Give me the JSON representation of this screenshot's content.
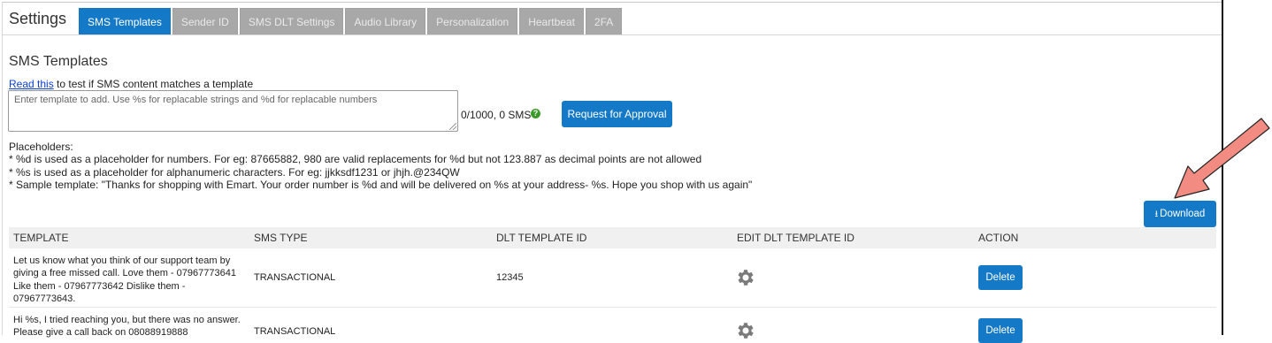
{
  "header": {
    "title": "Settings",
    "tabs": [
      {
        "label": "SMS Templates",
        "active": true
      },
      {
        "label": "Sender ID",
        "active": false
      },
      {
        "label": "SMS DLT Settings",
        "active": false
      },
      {
        "label": "Audio Library",
        "active": false
      },
      {
        "label": "Personalization",
        "active": false
      },
      {
        "label": "Heartbeat",
        "active": false
      },
      {
        "label": "2FA",
        "active": false
      }
    ]
  },
  "section": {
    "title": "SMS Templates",
    "read_link": "Read this",
    "read_suffix": " to test if SMS content matches a template",
    "input_placeholder": "Enter template to add. Use %s for replacable strings and %d for replacable numbers",
    "counter": "0/1000, 0 SMS",
    "help_icon": "question-circle-icon",
    "approve_button": "Request for Approval",
    "placeholders_heading": "Placeholders:",
    "placeholder_notes": [
      "* %d is used as a placeholder for numbers. For eg: 87665882, 980 are valid replacements for %d but not 123.887 as decimal points are not allowed",
      "* %s is used as a placeholder for alphanumeric characters. For eg: jjkksdf1231 or jhjh.@234QW",
      "* Sample template: \"Thanks for shopping with Emart. Your order number is %d and will be delivered on %s at your address- %s. Hope you shop with us again\""
    ],
    "download_button": "Download"
  },
  "table": {
    "columns": [
      "TEMPLATE",
      "SMS TYPE",
      "DLT TEMPLATE ID",
      "EDIT DLT TEMPLATE ID",
      "ACTION"
    ],
    "rows": [
      {
        "template": "Let us know what you think of our support team by giving a free missed call. Love them - 07967773641 Like them - 07967773642 Dislike them - 07967773643.",
        "sms_type": "TRANSACTIONAL",
        "dlt_template_id": "12345",
        "action": "Delete"
      },
      {
        "template": "Hi %s, I tried reaching you, but there was no answer. Please give a call back on 08088919888",
        "sms_type": "TRANSACTIONAL",
        "dlt_template_id": "",
        "action": "Delete"
      }
    ]
  },
  "colors": {
    "accent": "#1479c6",
    "tab_inactive": "#a8a8a8",
    "annotation_arrow": "#f28b82"
  }
}
